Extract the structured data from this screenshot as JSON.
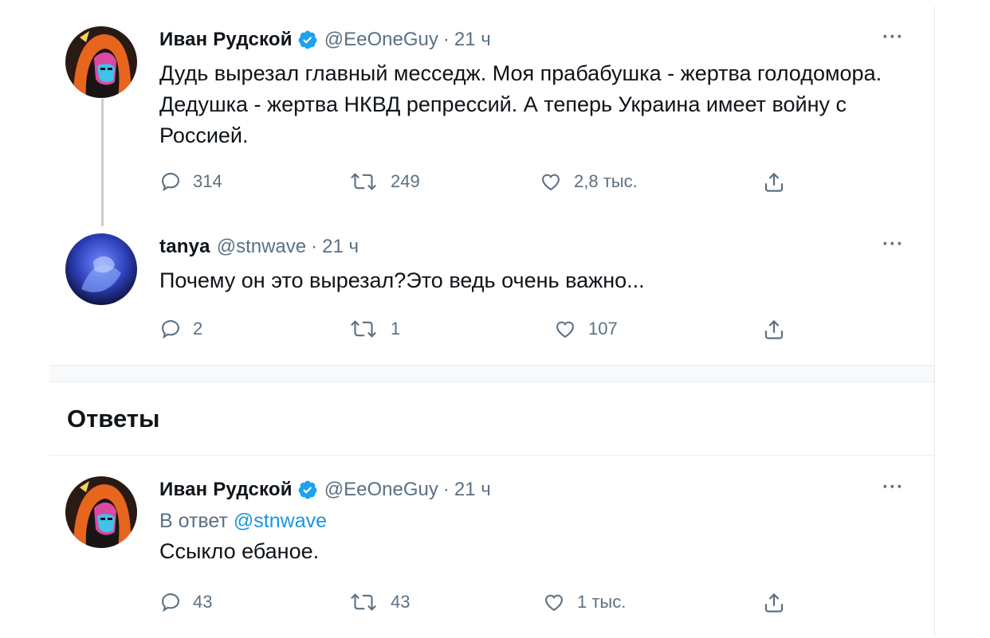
{
  "tweets": [
    {
      "name": "Иван Рудской",
      "handle": "@EeOneGuy",
      "sep": "·",
      "time": "21 ч",
      "text": "Дудь вырезал главный месседж. Моя прабабушка - жертва голодомора.\nДедушка - жертва НКВД репрессий. А теперь Украина имеет войну с\nРоссией.",
      "replies": "314",
      "retweets": "249",
      "likes": "2,8 тыс.",
      "more": "···"
    },
    {
      "name": "tanya",
      "handle": "@stnwave",
      "sep": "·",
      "time": "21 ч",
      "text": "Почему он это вырезал?Это ведь очень важно...",
      "replies": "2",
      "retweets": "1",
      "likes": "107",
      "more": "···"
    }
  ],
  "replies_section": {
    "title": "Ответы"
  },
  "reply_tweet": {
    "name": "Иван Рудской",
    "handle": "@EeOneGuy",
    "sep": "·",
    "time": "21 ч",
    "reply_prefix": "В ответ",
    "reply_mention": "@stnwave",
    "text": "Ссыкло ебаное.",
    "replies": "43",
    "retweets": "43",
    "likes": "1 тыс.",
    "more": "···"
  },
  "colors": {
    "accent": "#1da1f2",
    "secondary_text": "#5b7083",
    "divider": "#e6ecf0"
  },
  "icons": [
    "reply-icon",
    "retweet-icon",
    "like-icon",
    "share-icon",
    "verified-badge-icon",
    "more-icon"
  ]
}
